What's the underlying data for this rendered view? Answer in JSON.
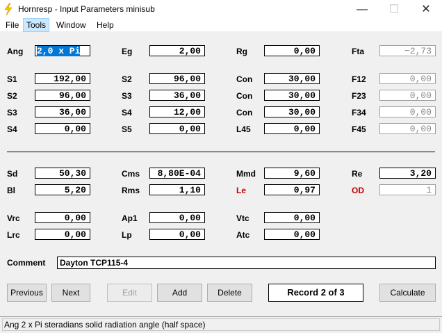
{
  "window": {
    "title": "Hornresp - Input Parameters   minisub",
    "minimize": "—",
    "maximize": "☐",
    "close": "✕"
  },
  "menu": [
    "File",
    "Tools",
    "Window",
    "Help"
  ],
  "params": {
    "Ang": {
      "label": "Ang",
      "value": "2,0 x Pi"
    },
    "Eg": {
      "label": "Eg",
      "value": "2,00"
    },
    "Rg": {
      "label": "Rg",
      "value": "0,00"
    },
    "Fta": {
      "label": "Fta",
      "value": "−2,73"
    },
    "S1": {
      "label": "S1",
      "value": "192,00"
    },
    "S2a": {
      "label": "S2",
      "value": "96,00"
    },
    "Con1": {
      "label": "Con",
      "value": "30,00"
    },
    "F12": {
      "label": "F12",
      "value": "0,00"
    },
    "S2": {
      "label": "S2",
      "value": "96,00"
    },
    "S3a": {
      "label": "S3",
      "value": "36,00"
    },
    "Con2": {
      "label": "Con",
      "value": "30,00"
    },
    "F23": {
      "label": "F23",
      "value": "0,00"
    },
    "S3": {
      "label": "S3",
      "value": "36,00"
    },
    "S4a": {
      "label": "S4",
      "value": "12,00"
    },
    "Con3": {
      "label": "Con",
      "value": "30,00"
    },
    "F34": {
      "label": "F34",
      "value": "0,00"
    },
    "S4": {
      "label": "S4",
      "value": "0,00"
    },
    "S5": {
      "label": "S5",
      "value": "0,00"
    },
    "L45": {
      "label": "L45",
      "value": "0,00"
    },
    "F45": {
      "label": "F45",
      "value": "0,00"
    },
    "Sd": {
      "label": "Sd",
      "value": "50,30"
    },
    "Cms": {
      "label": "Cms",
      "value": "8,80E-04"
    },
    "Mmd": {
      "label": "Mmd",
      "value": "9,60"
    },
    "Re": {
      "label": "Re",
      "value": "3,20"
    },
    "Bl": {
      "label": "Bl",
      "value": "5,20"
    },
    "Rms": {
      "label": "Rms",
      "value": "1,10"
    },
    "Le": {
      "label": "Le",
      "value": "0,97"
    },
    "Od": {
      "label": "OD",
      "value": "1"
    },
    "Vrc": {
      "label": "Vrc",
      "value": "0,00"
    },
    "Ap1": {
      "label": "Ap1",
      "value": "0,00"
    },
    "Vtc": {
      "label": "Vtc",
      "value": "0,00"
    },
    "Lrc": {
      "label": "Lrc",
      "value": "0,00"
    },
    "Lp": {
      "label": "Lp",
      "value": "0,00"
    },
    "Atc": {
      "label": "Atc",
      "value": "0,00"
    }
  },
  "comment": {
    "label": "Comment",
    "value": "Dayton TCP115-4"
  },
  "buttons": {
    "previous": "Previous",
    "next": "Next",
    "edit": "Edit",
    "add": "Add",
    "delete": "Delete",
    "calculate": "Calculate"
  },
  "record": "Record 2 of 3",
  "status": "Ang    2 x Pi steradians solid radiation angle  (half space)",
  "colors": {
    "accent_red": "#c00000",
    "selection": "#0078d7"
  }
}
